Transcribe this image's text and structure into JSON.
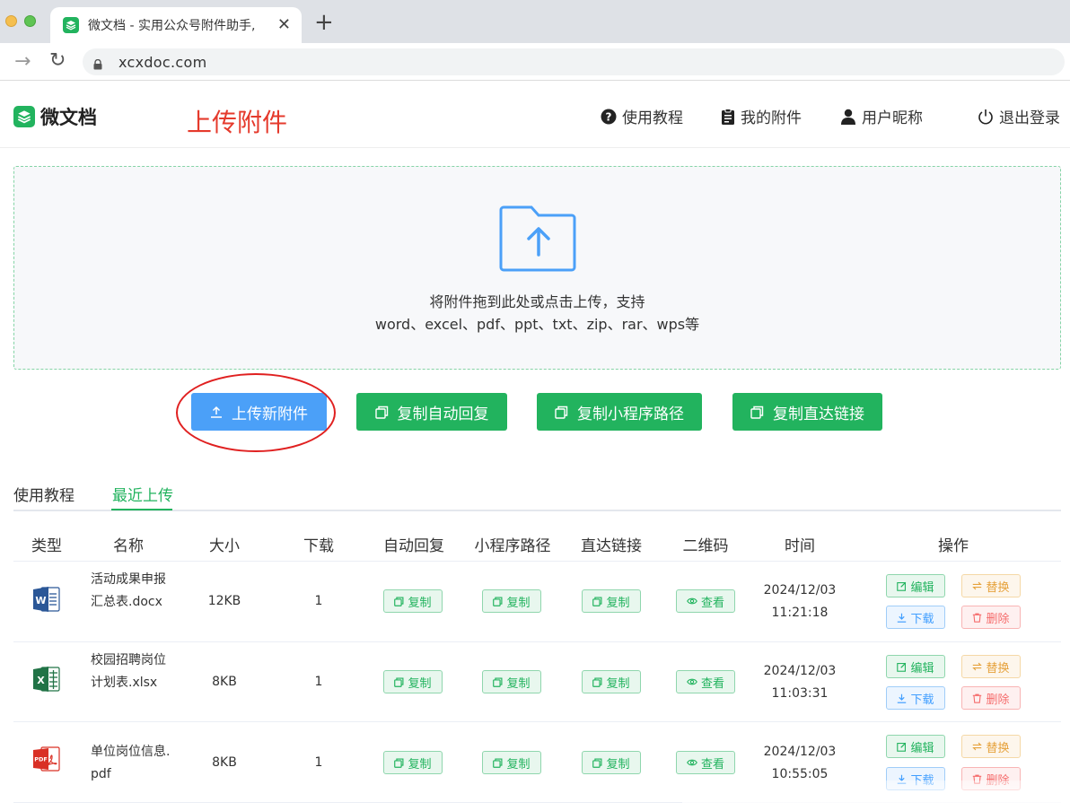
{
  "browser": {
    "tab_title": "微文档 - 实用公众号附件助手, ",
    "url": "xcxdoc.com"
  },
  "header": {
    "logo_text": "微文档",
    "annotation": "上传附件",
    "nav": [
      "使用教程",
      "我的附件",
      "用户昵称",
      "退出登录"
    ]
  },
  "upload": {
    "line1": "将附件拖到此处或点击上传，支持",
    "line2": "word、excel、pdf、ppt、txt、zip、rar、wps等"
  },
  "actions": [
    "上传新附件",
    "复制自动回复",
    "复制小程序路径",
    "复制直达链接"
  ],
  "tabs": [
    "使用教程",
    "最近上传"
  ],
  "active_tab": "最近上传",
  "table": {
    "headers": [
      "类型",
      "名称",
      "大小",
      "下载",
      "自动回复",
      "小程序路径",
      "直达链接",
      "二维码",
      "时间",
      "操作"
    ],
    "rows": [
      {
        "type": "word",
        "name": "活动成果申报汇总表.docx",
        "size": "12KB",
        "downloads": "1",
        "auto_reply": "复制",
        "mini_path": "复制",
        "direct_link": "复制",
        "qrcode": "查看",
        "time": "2024/12/03 11:21:18",
        "edit": "编辑",
        "replace": "替换",
        "download": "下载",
        "delete": "删除"
      },
      {
        "type": "excel",
        "name": "校园招聘岗位计划表.xlsx",
        "size": "8KB",
        "downloads": "1",
        "auto_reply": "复制",
        "mini_path": "复制",
        "direct_link": "复制",
        "qrcode": "查看",
        "time": "2024/12/03 11:03:31",
        "edit": "编辑",
        "replace": "替换",
        "download": "下载",
        "delete": "删除"
      },
      {
        "type": "pdf",
        "name": "单位岗位信息.pdf",
        "size": "8KB",
        "downloads": "1",
        "auto_reply": "复制",
        "mini_path": "复制",
        "direct_link": "复制",
        "qrcode": "查看",
        "time": "2024/12/03 10:55:05",
        "edit": "编辑",
        "replace": "替换",
        "download": "下载",
        "delete": "删除"
      }
    ]
  },
  "colors": {
    "brand": "#22b35e",
    "primary_blue": "#4ba0f8",
    "annotation_red": "#e53a2c"
  },
  "icons": {
    "word": "word-file-icon",
    "excel": "excel-file-icon",
    "pdf": "pdf-file-icon"
  }
}
